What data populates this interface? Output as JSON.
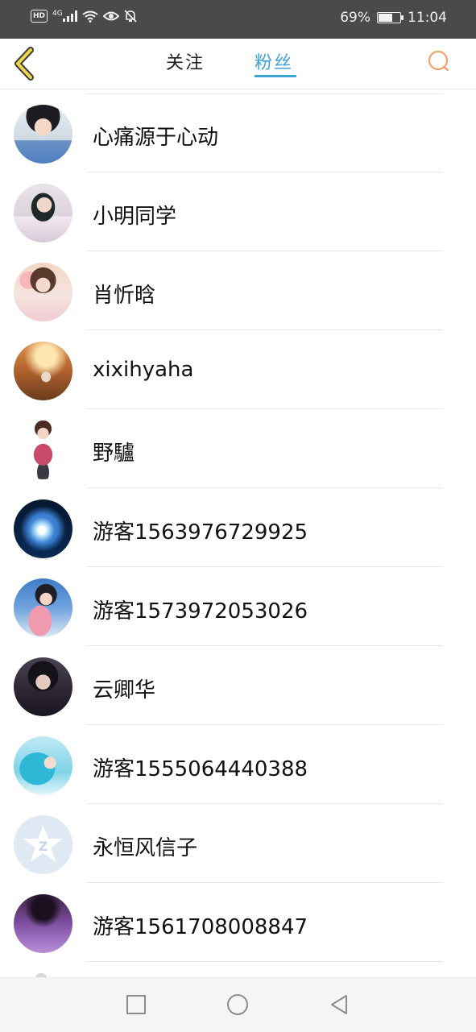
{
  "status_bar": {
    "hd_label": "HD",
    "network": "4G",
    "battery_percent": "69%",
    "battery_level": 0.69,
    "time": "11:04",
    "icons": [
      "signal-icon",
      "wifi-icon",
      "eye-icon",
      "mute-icon",
      "battery-icon"
    ]
  },
  "header": {
    "tabs": [
      {
        "label": "关注",
        "active": false
      },
      {
        "label": "粉丝",
        "active": true
      }
    ],
    "accent_color": "#3fa2d6",
    "back_icon": "chevron-left-icon",
    "search_icon": "search-icon"
  },
  "list": {
    "items": [
      {
        "name": "心痛源于心动",
        "avatar": "boy-portrait"
      },
      {
        "name": "小明同学",
        "avatar": "girl-portrait"
      },
      {
        "name": "肖忻晗",
        "avatar": "girl-flowers"
      },
      {
        "name": "xixihyaha",
        "avatar": "sunset-silhouette"
      },
      {
        "name": "野驢",
        "avatar": "child-figure"
      },
      {
        "name": "游客1563976729925",
        "avatar": "glowing-flower"
      },
      {
        "name": "游客1573972053026",
        "avatar": "girl-pink"
      },
      {
        "name": "云卿华",
        "avatar": "dark-portrait"
      },
      {
        "name": "游客1555064440388",
        "avatar": "anime-teal"
      },
      {
        "name": "永恒风信子",
        "avatar": "default-star"
      },
      {
        "name": "游客1561708008847",
        "avatar": "lavender-field"
      }
    ]
  },
  "nav_bar": {
    "buttons": [
      "recent-apps-icon",
      "home-icon",
      "back-icon"
    ]
  }
}
